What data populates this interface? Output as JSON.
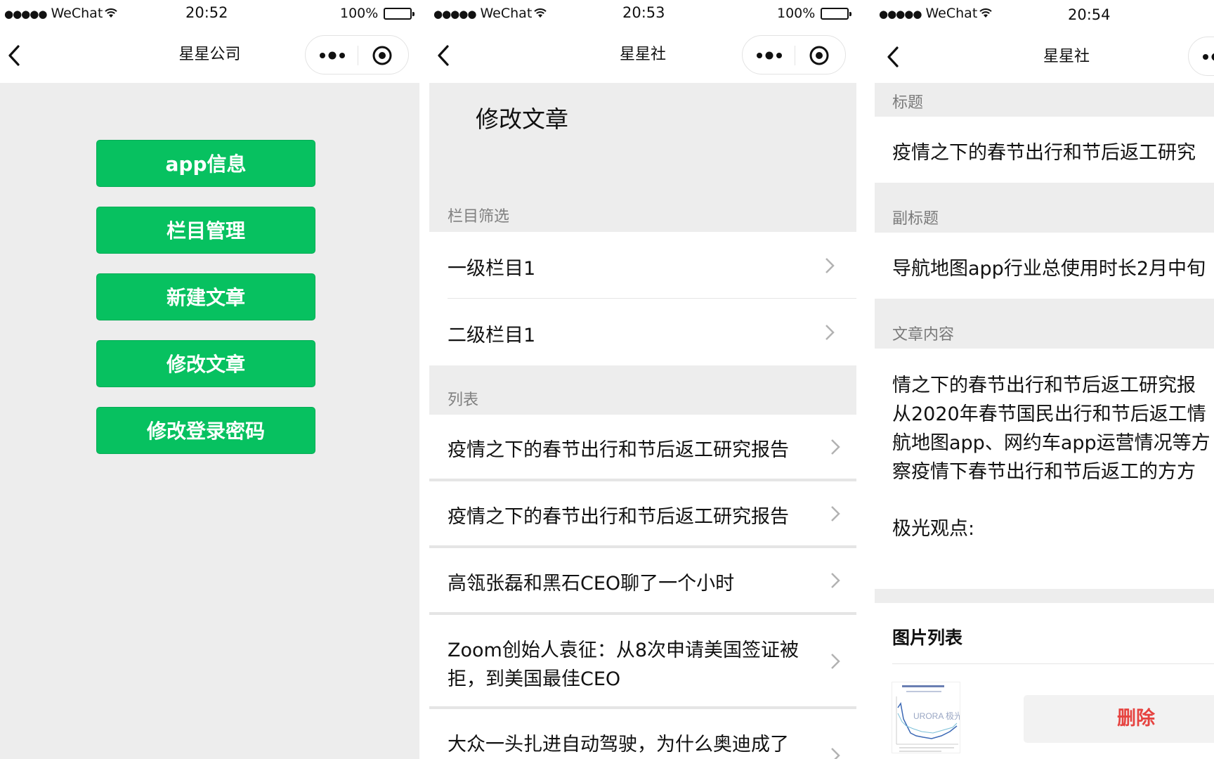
{
  "panel1": {
    "status": {
      "carrier": "WeChat",
      "time": "20:52",
      "battery": "100%"
    },
    "nav_title": "星星公司",
    "buttons": [
      "app信息",
      "栏目管理",
      "新建文章",
      "修改文章",
      "修改登录密码"
    ],
    "colors": {
      "button_green": "#07c160"
    }
  },
  "panel2": {
    "status": {
      "carrier": "WeChat",
      "time": "20:53",
      "battery": "100%"
    },
    "nav_title": "星星社",
    "heading": "修改文章",
    "filter_label": "栏目筛选",
    "filters": [
      "一级栏目1",
      "二级栏目1"
    ],
    "list_label": "列表",
    "articles": [
      "疫情之下的春节出行和节后返工研究报告",
      "疫情之下的春节出行和节后返工研究报告",
      "高瓴张磊和黑石CEO聊了一个小时",
      "Zoom创始人袁征：从8次申请美国签证被",
      "拒，到美国最佳CEO",
      "大众一头扎进自动驾驶，为什么奥迪成了"
    ]
  },
  "panel3": {
    "status": {
      "carrier": "WeChat",
      "time": "20:54"
    },
    "nav_title": "星星社",
    "title_label": "标题",
    "title_value": "疫情之下的春节出行和节后返工研究",
    "subtitle_label": "副标题",
    "subtitle_value": "导航地图app行业总使用时长2月中旬",
    "content_label": "文章内容",
    "content_lines": [
      "情之下的春节出行和节后返工研究报",
      "从2020年春节国民出行和节后返工情",
      "航地图app、网约车app运营情况等方",
      "察疫情下春节出行和节后返工的方方"
    ],
    "content_extra": "极光观点:",
    "image_list_label": "图片列表",
    "thumb_text": "URORA 极光",
    "delete_label": "删除",
    "colors": {
      "delete_red": "#e64340"
    }
  }
}
